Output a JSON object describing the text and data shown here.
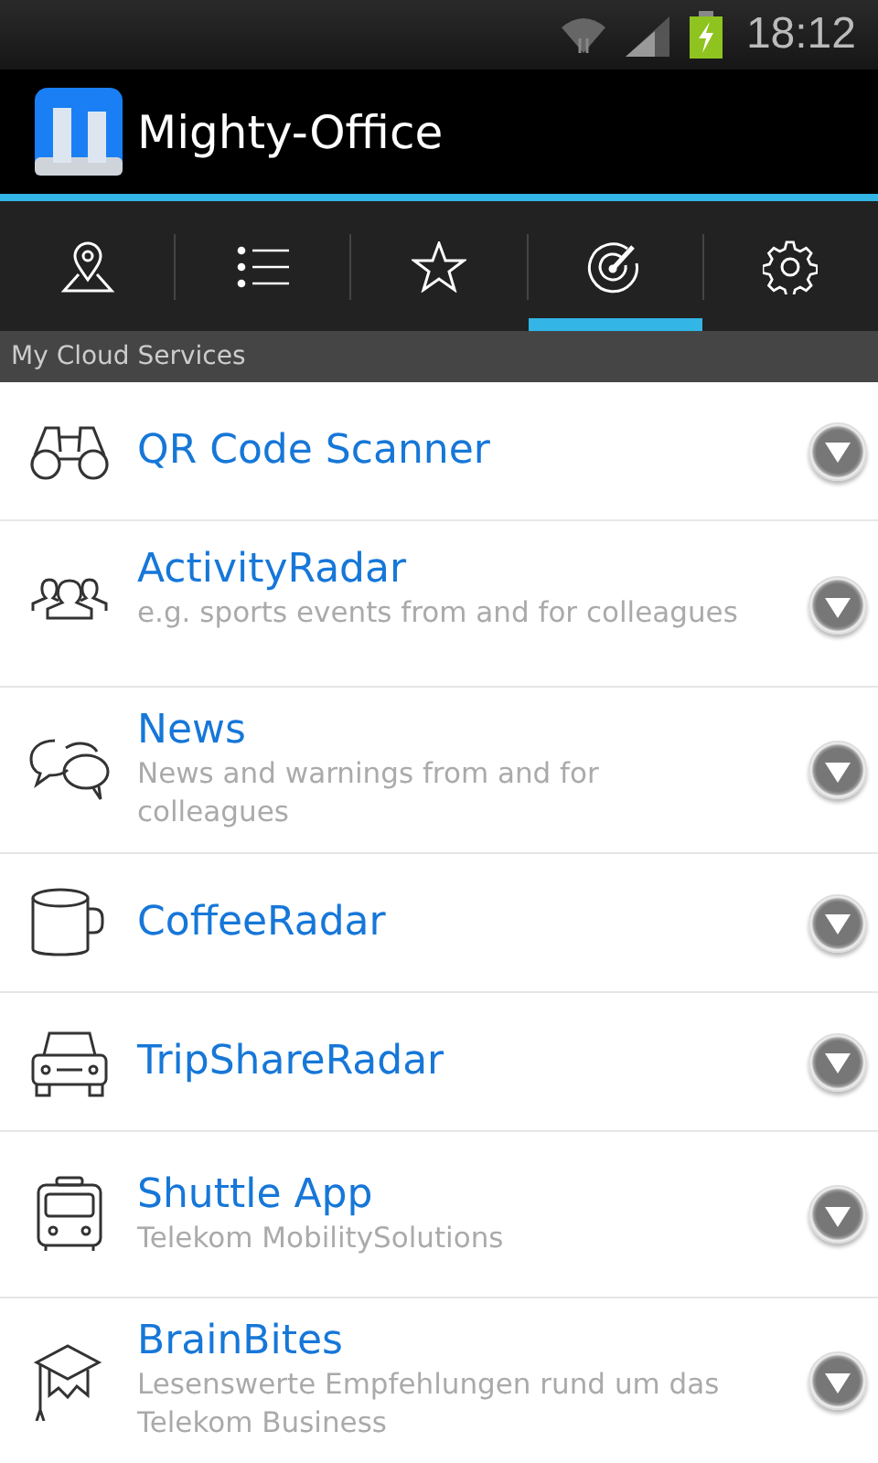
{
  "status_bar": {
    "time": "18:12"
  },
  "app_bar": {
    "title": "Mighty-Office"
  },
  "tabs": [
    {
      "selected": false
    },
    {
      "selected": false
    },
    {
      "selected": false
    },
    {
      "selected": true
    },
    {
      "selected": false
    }
  ],
  "section_header": "My Cloud Services",
  "services": [
    {
      "title": "QR Code Scanner"
    },
    {
      "title": "ActivityRadar",
      "subtitle": "e.g. sports events from and for colleagues"
    },
    {
      "title": "News",
      "subtitle": "News and warnings from and for colleagues"
    },
    {
      "title": "CoffeeRadar"
    },
    {
      "title": "TripShareRadar"
    },
    {
      "title": "Shuttle App",
      "subtitle": "Telekom MobilitySolutions"
    },
    {
      "title": "BrainBites",
      "subtitle": "Lesenswerte Empfehlungen rund um das Telekom Business"
    }
  ]
}
